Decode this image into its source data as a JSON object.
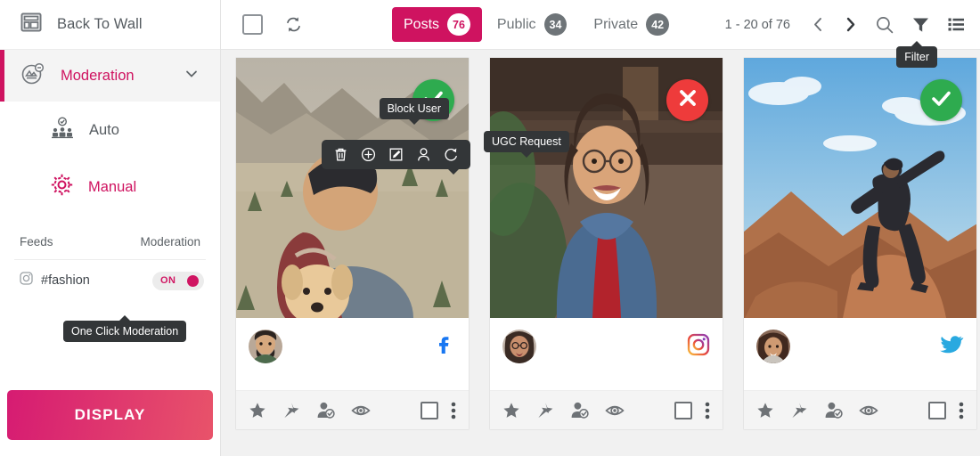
{
  "sidebar": {
    "back_to_wall": {
      "label": "Back To Wall",
      "icon": "layout-grid-icon"
    },
    "moderation": {
      "label": "Moderation",
      "icon": "moderation-image-icon",
      "chevron": "chevron-down-icon"
    },
    "sub_items": [
      {
        "label": "Auto",
        "icon": "auto-moderation-group-icon",
        "active": false
      },
      {
        "label": "Manual",
        "icon": "gear-icon",
        "active": true
      }
    ],
    "feeds_header": {
      "feeds": "Feeds",
      "moderation": "Moderation"
    },
    "feed_row": {
      "name": "#fashion",
      "network_icon": "instagram-icon",
      "toggle_label": "ON",
      "toggle_on": true
    },
    "tooltip_one_click": "One Click Moderation",
    "display_button": "DISPLAY"
  },
  "topbar": {
    "select_all_checkbox": "select-all-checkbox",
    "refresh_icon": "refresh-icon",
    "tabs": [
      {
        "label": "Posts",
        "count": "76",
        "active": true
      },
      {
        "label": "Public",
        "count": "34",
        "active": false
      },
      {
        "label": "Private",
        "count": "42",
        "active": false
      }
    ],
    "pager": "1 - 20 of 76",
    "prev_icon": "chevron-left-icon",
    "next_icon": "chevron-right-icon",
    "search_icon": "search-icon",
    "filter_icon": "filter-icon",
    "list_icon": "list-view-icon",
    "tooltip_filter": "Filter"
  },
  "cards": [
    {
      "id": "card-1",
      "status": "approved",
      "status_icon": "check-circle-icon",
      "network": "facebook",
      "network_icon": "facebook-icon",
      "footer_icons": [
        "star-icon",
        "pin-icon",
        "ugc-request-icon",
        "eye-icon"
      ],
      "footer_checkbox": "select-post-checkbox",
      "footer_more": "more-options-icon",
      "action_menu": {
        "visible": true,
        "icons": [
          "trash-icon",
          "plus-circle-icon",
          "edit-icon",
          "block-user-icon",
          "refresh-icon"
        ],
        "tooltip": "Block User"
      }
    },
    {
      "id": "card-2",
      "status": "rejected",
      "status_icon": "x-circle-icon",
      "network": "instagram",
      "network_icon": "instagram-icon",
      "footer_icons": [
        "star-icon",
        "pin-icon",
        "ugc-request-icon",
        "eye-icon"
      ],
      "footer_checkbox": "select-post-checkbox",
      "footer_more": "more-options-icon",
      "tooltip": "UGC Request"
    },
    {
      "id": "card-3",
      "status": "approved",
      "status_icon": "check-circle-icon",
      "network": "twitter",
      "network_icon": "twitter-icon",
      "footer_icons": [
        "star-icon",
        "pin-icon",
        "ugc-request-icon",
        "eye-icon"
      ],
      "footer_checkbox": "select-post-checkbox",
      "footer_more": "more-options-icon"
    }
  ],
  "colors": {
    "brand_pink": "#cf1360",
    "approved_green": "#2eab4f",
    "rejected_red": "#ee3b3b",
    "tooltip_dark": "#333638",
    "facebook_blue": "#1877f2",
    "twitter_blue": "#29a9e0"
  }
}
